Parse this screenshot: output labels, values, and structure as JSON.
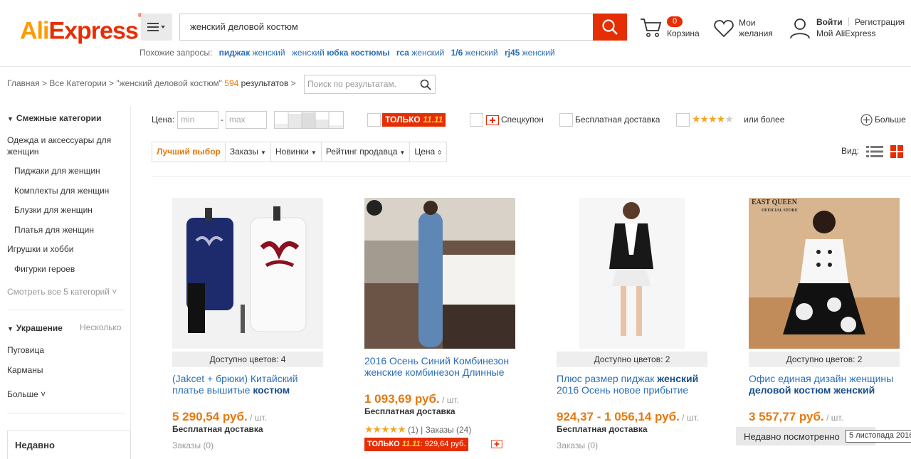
{
  "header": {
    "logo_ali": "Ali",
    "logo_express": "Express",
    "logo_tm": "®",
    "search_value": "женский деловой костюм",
    "related_label": "Похожие запросы:",
    "related": [
      {
        "bold": "пиджак",
        "rest": " женский"
      },
      {
        "bold": "",
        "rest": "женский ",
        "bold2": "юбка костюмы"
      },
      {
        "bold": "rca",
        "rest": " женский"
      },
      {
        "bold": "1/6",
        "rest": " женский"
      },
      {
        "bold": "rj45",
        "rest": " женский"
      }
    ],
    "cart_count": "0",
    "cart_label": "Корзина",
    "wish_label": "Мои желания",
    "login": "Войти",
    "register": "Регистрация",
    "my_ali": "Мой AliExpress"
  },
  "breadcrumb": {
    "home": "Главная",
    "all": "Все Категории",
    "query": "\"женский деловой костюм\"",
    "count": "594",
    "results": "результатов",
    "refine_placeholder": "Поиск по результатам."
  },
  "sidebar": {
    "related_header": "Смежные категории",
    "cat_main": "Одежда и аксессуары для женщин",
    "subcats": [
      "Пиджаки для женщин",
      "Комплекты для женщин",
      "Блузки для женщин",
      "Платья для женщин"
    ],
    "toys": "Игрушки и хобби",
    "heroes": "Фигурки героев",
    "see_all": "Смотреть все 5 категорий",
    "decor_header": "Украшение",
    "decor_multi": "Несколько",
    "decor_items": [
      "Пуговица",
      "Карманы"
    ],
    "more": "Больше",
    "recent": "Недавно"
  },
  "filters": {
    "price_label": "Цена:",
    "min_placeholder": "min",
    "max_placeholder": "max",
    "only1111_a": "ТОЛЬКО",
    "only1111_b": "11.11",
    "coupon": "Спецкупон",
    "free_ship": "Бесплатная доставка",
    "rating_more": "или более",
    "more": "Больше"
  },
  "sort": {
    "best": "Лучший выбор",
    "orders": "Заказы",
    "new": "Новинки",
    "seller": "Рейтинг продавца",
    "price": "Цена",
    "view_label": "Вид:"
  },
  "products": [
    {
      "colors": "Доступно цветов: 4",
      "title_plain": "(Jakcet + брюки) Китайский платье вышитые ",
      "title_bold": "костюм",
      "price": "5 290,54 руб.",
      "unit": " / шт.",
      "ship": "Бесплатная доставка",
      "orders": "Заказы (0)"
    },
    {
      "title_plain": "2016 Осень Синий Комбинезон женские комбинезон Длинные",
      "price": "1 093,69 руб.",
      "unit": " / шт.",
      "ship": "Бесплатная доставка",
      "rating": "(1)",
      "orders": "Заказы (24)",
      "promo_a": "ТОЛЬКО",
      "promo_b": "11.11",
      "promo_price": ": 929,64 руб."
    },
    {
      "colors": "Доступно цветов: 2",
      "title_plain": "Плюс размер пиджак ",
      "title_bold": "женский",
      "title_plain2": " 2016 Осень новое прибытие",
      "price": "924,37 - 1 056,14 руб.",
      "unit": " / шт.",
      "ship": "Бесплатная доставка",
      "orders": "Заказы (0)"
    },
    {
      "colors": "Доступно цветов: 2",
      "title_plain": "Офис единая дизайн женщины ",
      "title_bold": "деловой костюм женский",
      "price": "3 557,77 руб.",
      "unit": " / шт.",
      "brand": "EAST QUEEN",
      "brand_sub": "OFFICIAL STORE"
    }
  ],
  "bottom": {
    "recent_bar": "Недавно посмотренно",
    "tooltip": "5 листопада 2016"
  },
  "colors": {
    "accent": "#e62e04",
    "orange": "#e47911",
    "link": "#2a6fb6"
  }
}
